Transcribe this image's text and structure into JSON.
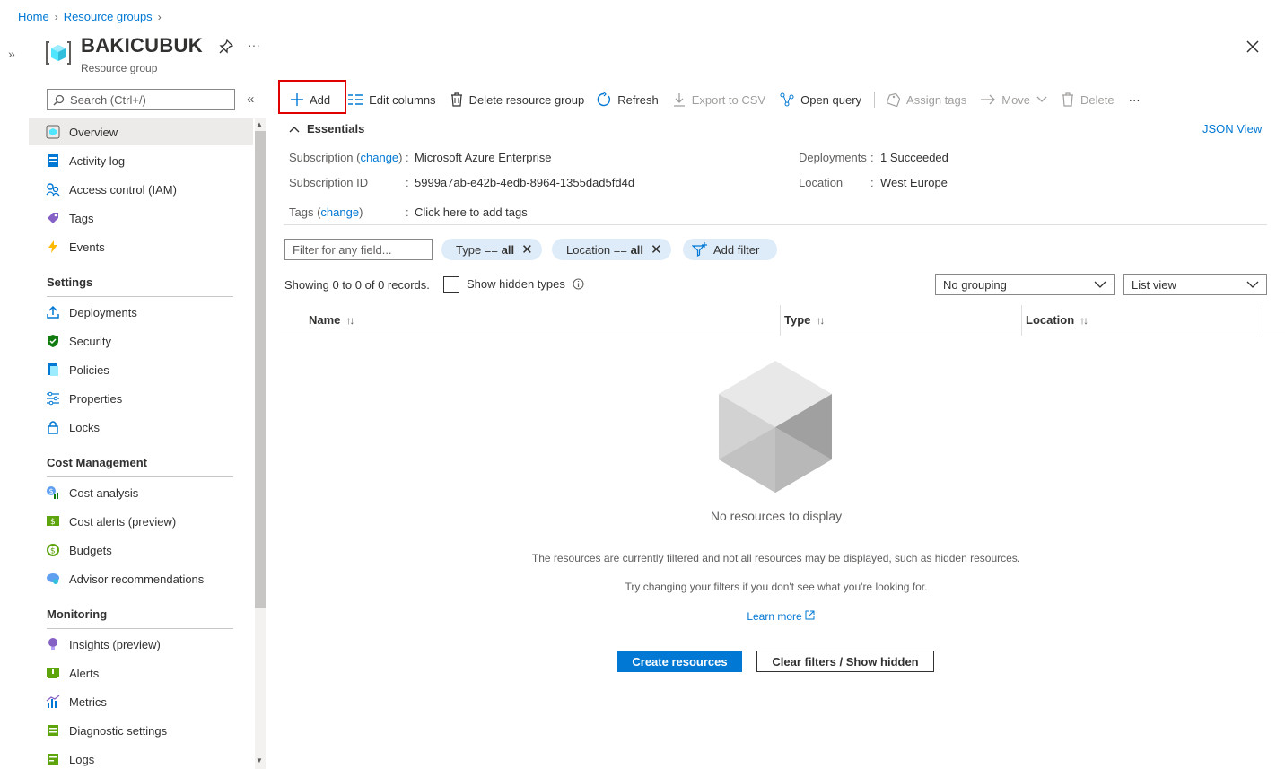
{
  "breadcrumb": {
    "home": "Home",
    "sep": ">",
    "resource_groups": "Resource groups"
  },
  "header": {
    "title": "BAKICUBUK",
    "subtitle": "Resource group",
    "more": "···"
  },
  "sidebar": {
    "search_placeholder": "Search (Ctrl+/)",
    "collapse": "«",
    "expand": "»",
    "top_items": [
      {
        "label": "Overview",
        "icon": "overview-icon",
        "selected": true
      },
      {
        "label": "Activity log",
        "icon": "activity-log-icon"
      },
      {
        "label": "Access control (IAM)",
        "icon": "iam-icon"
      },
      {
        "label": "Tags",
        "icon": "tag-icon"
      },
      {
        "label": "Events",
        "icon": "lightning-icon"
      }
    ],
    "settings_header": "Settings",
    "settings_items": [
      {
        "label": "Deployments",
        "icon": "upload-icon"
      },
      {
        "label": "Security",
        "icon": "shield-icon"
      },
      {
        "label": "Policies",
        "icon": "policy-icon"
      },
      {
        "label": "Properties",
        "icon": "properties-icon"
      },
      {
        "label": "Locks",
        "icon": "lock-icon"
      }
    ],
    "cost_header": "Cost Management",
    "cost_items": [
      {
        "label": "Cost analysis",
        "icon": "cost-analysis-icon"
      },
      {
        "label": "Cost alerts (preview)",
        "icon": "cost-alerts-icon"
      },
      {
        "label": "Budgets",
        "icon": "budget-icon"
      },
      {
        "label": "Advisor recommendations",
        "icon": "advisor-icon"
      }
    ],
    "monitoring_header": "Monitoring",
    "monitoring_items": [
      {
        "label": "Insights (preview)",
        "icon": "insights-icon"
      },
      {
        "label": "Alerts",
        "icon": "alerts-icon"
      },
      {
        "label": "Metrics",
        "icon": "metrics-icon"
      },
      {
        "label": "Diagnostic settings",
        "icon": "diagnostic-icon"
      },
      {
        "label": "Logs",
        "icon": "logs-icon"
      }
    ]
  },
  "toolbar": {
    "add": "Add",
    "edit_columns": "Edit columns",
    "delete_rg": "Delete resource group",
    "refresh": "Refresh",
    "export_csv": "Export to CSV",
    "open_query": "Open query",
    "assign_tags": "Assign tags",
    "move": "Move",
    "delete": "Delete",
    "more": "···"
  },
  "essentials": {
    "toggle": "Essentials",
    "json_view": "JSON View",
    "subscription_label": "Subscription",
    "change": "change",
    "subscription_value": "Microsoft Azure Enterprise",
    "subscription_id_label": "Subscription ID",
    "subscription_id_value": "5999a7ab-e42b-4edb-8964-1355dad5fd4d",
    "tags_label": "Tags",
    "tags_value": "Click here to add tags",
    "deployments_label": "Deployments",
    "deployments_value": "1 Succeeded",
    "location_label": "Location",
    "location_value": "West Europe",
    "colon": ":"
  },
  "filters": {
    "placeholder": "Filter for any field...",
    "type_pill_key": "Type ==",
    "type_pill_val": "all",
    "location_pill_key": "Location ==",
    "location_pill_val": "all",
    "add_filter": "Add filter"
  },
  "list": {
    "records": "Showing 0 to 0 of 0 records.",
    "show_hidden": "Show hidden types",
    "grouping": "No grouping",
    "view": "List view",
    "columns": [
      "Name",
      "Type",
      "Location"
    ]
  },
  "empty": {
    "title": "No resources to display",
    "desc1": "The resources are currently filtered and not all resources may be displayed, such as hidden resources.",
    "desc2": "Try changing your filters if you don't see what you're looking for.",
    "learn_more": "Learn more",
    "create": "Create resources",
    "clear": "Clear filters / Show hidden"
  },
  "colors": {
    "accent": "#0078d4",
    "pill": "#deecf9",
    "highlight": "#e00000"
  }
}
